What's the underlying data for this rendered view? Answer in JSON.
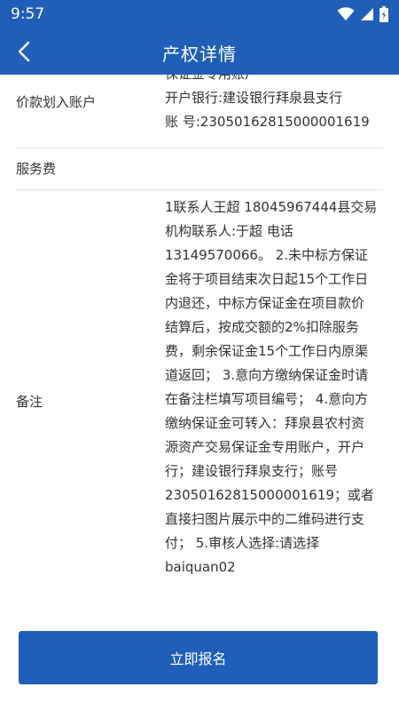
{
  "status_bar": {
    "time": "9:57"
  },
  "app_bar": {
    "title": "产权详情"
  },
  "rows": {
    "account": {
      "label": "价款划入账户",
      "lines": [
        "保证金专用账户",
        "开户银行:建设银行拜泉县支行",
        "账 号:23050162815000001619"
      ]
    },
    "fee": {
      "label": "服务费",
      "value": ""
    },
    "remark": {
      "label": "备注",
      "lines": [
        "1联系人王超 18045967444县交易",
        "机构联系人:于超 电话",
        "13149570066。 2.未中标方保证",
        "金将于项目结束次日起15个工作日",
        "内退还，中标方保证金在项目款价",
        "结算后，按成交额的2%扣除服务",
        "费，剩余保证金15个工作日内原渠",
        "道返回； 3.意向方缴纳保证金时请",
        "在备注栏填写项目编号； 4.意向方",
        "缴纳保证金可转入：拜泉县农村资",
        "源资产交易保证金专用账户，开户",
        "行；建设银行拜泉支行；账号",
        "23050162815000001619；或者",
        "直接扫图片展示中的二维码进行支",
        "付； 5.审核人选择:请选择",
        "baiquan02"
      ]
    }
  },
  "actions": {
    "submit_label": "立即报名"
  },
  "colors": {
    "primary": "#1f5fb8",
    "divider": "#e3e3e3"
  },
  "icons": {
    "back": "chevron-left-icon",
    "wifi": "wifi-icon",
    "signal": "signal-icon",
    "battery": "battery-icon"
  }
}
